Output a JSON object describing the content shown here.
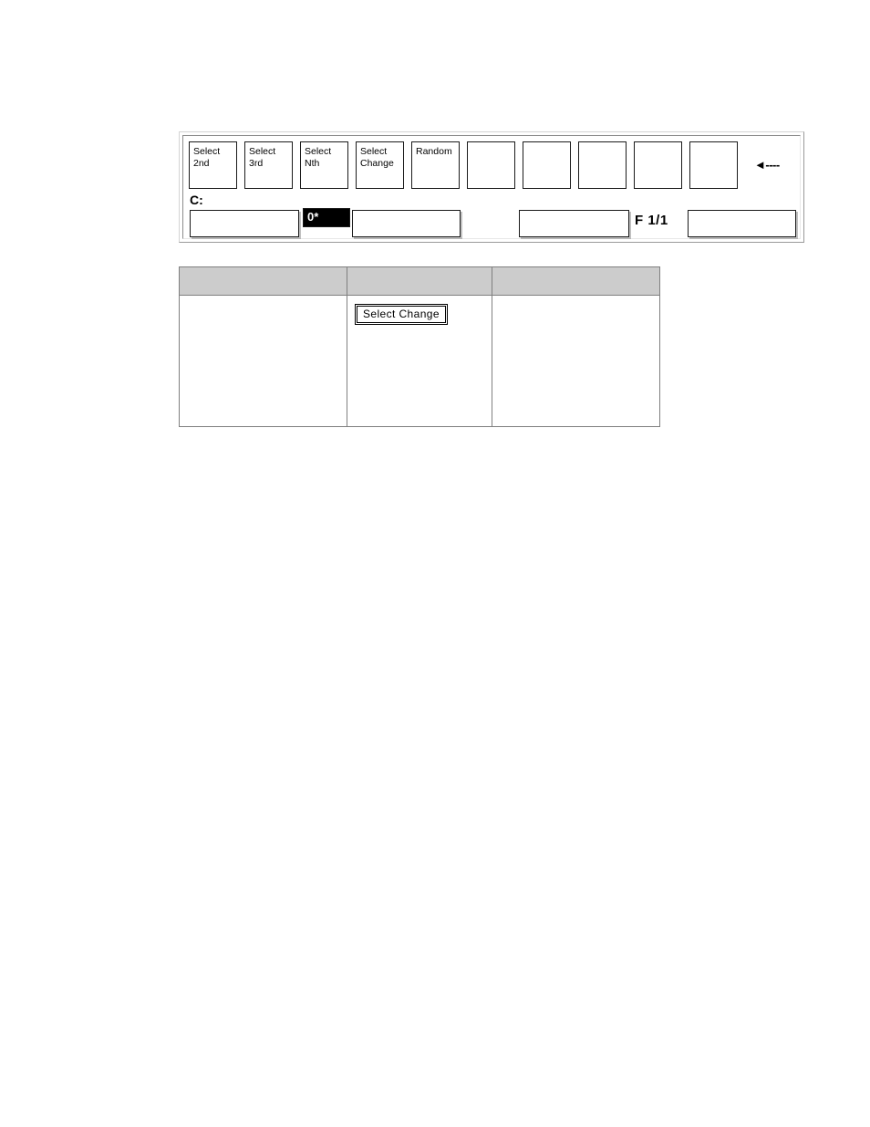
{
  "panel": {
    "function_keys": [
      {
        "label": "Select\n2nd",
        "empty": false
      },
      {
        "label": "Select\n3rd",
        "empty": false
      },
      {
        "label": "Select\nNth",
        "empty": false
      },
      {
        "label": "Select\nChange",
        "empty": false
      },
      {
        "label": "Random",
        "empty": false
      },
      {
        "label": "",
        "empty": true
      },
      {
        "label": "",
        "empty": true
      },
      {
        "label": "",
        "empty": true
      },
      {
        "label": "",
        "empty": true
      },
      {
        "label": "",
        "empty": true
      }
    ],
    "back_arrow": "◄----",
    "status_label": "C:",
    "entry_fields": [
      {
        "value": ""
      },
      {
        "value": ""
      },
      {
        "value": ""
      },
      {
        "value": ""
      }
    ],
    "count_field": {
      "value": "0*",
      "background": "#000000",
      "foreground": "#ffffff"
    },
    "page_indicator": "F 1/1"
  },
  "description_table": {
    "header_background": "#cccccc",
    "headers": [
      "",
      "",
      ""
    ],
    "rows": [
      {
        "cells": [
          {
            "text": "",
            "button": null
          },
          {
            "text": "",
            "button": "Select Change"
          },
          {
            "text": "",
            "button": null
          }
        ]
      }
    ]
  }
}
